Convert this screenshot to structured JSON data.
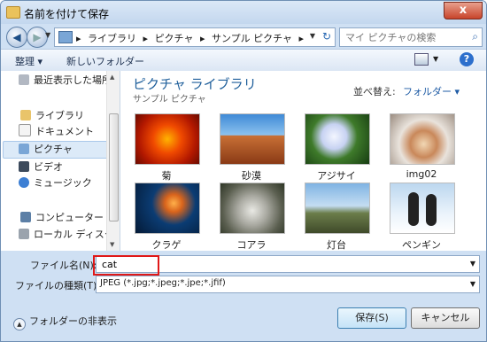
{
  "window": {
    "title": "名前を付けて保存",
    "close": "x"
  },
  "nav": {
    "back": "◀",
    "forward": "▶",
    "breadcrumbs": [
      "ライブラリ",
      "ピクチャ",
      "サンプル ピクチャ"
    ],
    "refresh": "↻",
    "search_placeholder": "マイ ピクチャの検索"
  },
  "toolbar": {
    "organize": "整理 ▾",
    "new_folder": "新しいフォルダー",
    "help": "?"
  },
  "sidebar": {
    "items": [
      {
        "label": "最近表示した場所"
      },
      {
        "label": "ライブラリ"
      },
      {
        "label": "ドキュメント"
      },
      {
        "label": "ピクチャ",
        "selected": true
      },
      {
        "label": "ビデオ"
      },
      {
        "label": "ミュージック"
      },
      {
        "label": "コンピューター"
      },
      {
        "label": "ローカル ディスク"
      }
    ]
  },
  "library": {
    "title": "ピクチャ ライブラリ",
    "subtitle": "サンプル ピクチャ",
    "arrange_label": "並べ替え:",
    "arrange_value": "フォルダー ▾",
    "images": [
      {
        "name": "菊"
      },
      {
        "name": "砂漠"
      },
      {
        "name": "アジサイ"
      },
      {
        "name": "img02"
      },
      {
        "name": "クラゲ"
      },
      {
        "name": "コアラ"
      },
      {
        "name": "灯台"
      },
      {
        "name": "ペンギン"
      }
    ]
  },
  "form": {
    "filename_label": "ファイル名(N):",
    "filename_value": "cat",
    "filetype_label": "ファイルの種類(T):",
    "filetype_value": "JPEG (*.jpg;*.jpeg;*.jpe;*.jfif)",
    "hide_folders": "フォルダーの非表示",
    "save_button": "保存(S)",
    "cancel_button": "キャンセル"
  }
}
